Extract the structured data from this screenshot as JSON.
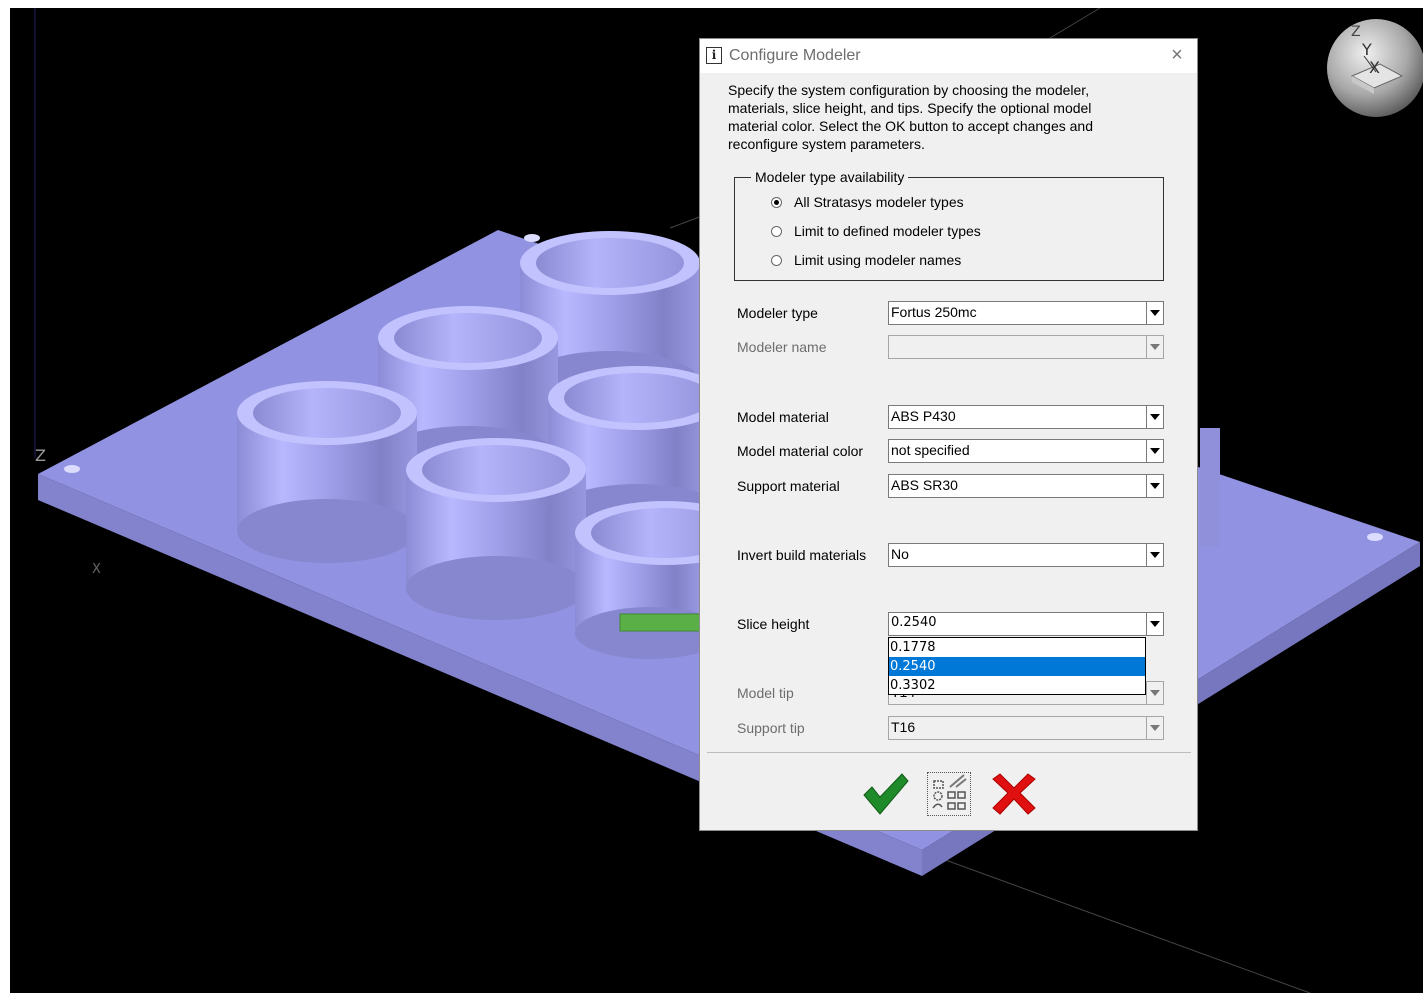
{
  "viewport": {
    "axis_labels": {
      "z": "Z",
      "x": "X"
    },
    "cube_labels": {
      "z": "Z",
      "y": "Y",
      "x": "X"
    }
  },
  "dialog": {
    "title": "Configure Modeler",
    "title_icon": "info-icon",
    "close_label": "×",
    "description": "Specify the system configuration by choosing the modeler, materials, slice height, and tips. Specify the optional model material color. Select the OK button to accept changes and reconfigure system parameters.",
    "availability": {
      "legend": "Modeler type availability",
      "options": [
        {
          "label": "All Stratasys modeler types",
          "checked": true
        },
        {
          "label": "Limit to defined modeler types",
          "checked": false
        },
        {
          "label": "Limit using modeler names",
          "checked": false
        }
      ]
    },
    "fields": {
      "modeler_type": {
        "label": "Modeler type",
        "value": "Fortus 250mc"
      },
      "modeler_name": {
        "label": "Modeler name",
        "value": ""
      },
      "model_material": {
        "label": "Model material",
        "value": "ABS P430"
      },
      "model_material_color": {
        "label": "Model material color",
        "value": "not specified"
      },
      "support_material": {
        "label": "Support material",
        "value": "ABS SR30"
      },
      "invert_build": {
        "label": "Invert build materials",
        "value": "No"
      },
      "slice_height": {
        "label": "Slice height",
        "value": "0.2540",
        "options": [
          "0.1778",
          "0.2540",
          "0.3302"
        ],
        "selected_index": 1
      },
      "model_tip": {
        "label": "Model tip",
        "value": "T14"
      },
      "support_tip": {
        "label": "Support tip",
        "value": "T16"
      }
    },
    "buttons": {
      "ok": "checkmark-icon",
      "settings": "settings-icon",
      "cancel": "red-x-icon"
    }
  },
  "colors": {
    "viewport_background": "#000000",
    "model": "#a4a4f0",
    "highlight_arrow": "#5ab047",
    "selection": "#0078d7",
    "ok_green": "#1e8a2a",
    "cancel_red": "#e01010"
  }
}
